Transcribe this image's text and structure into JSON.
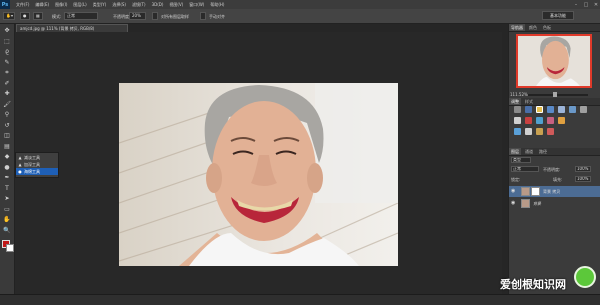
{
  "app": {
    "logo": "Ps",
    "window_controls": [
      "–",
      "□",
      "✕"
    ]
  },
  "menu": [
    "文件(F)",
    "编辑(E)",
    "图像(I)",
    "图层(L)",
    "类型(Y)",
    "选择(S)",
    "滤镜(T)",
    "3D(D)",
    "视图(V)",
    "窗口(W)",
    "帮助(H)"
  ],
  "options_bar": {
    "mode_label": "模式:",
    "mode_value": "正常",
    "opacity_label": "不透明度:",
    "opacity_value": "20%",
    "align_label": "对所有图层取样",
    "sample_label": "手动对齐",
    "workspace": "基本功能"
  },
  "document": {
    "tab_label": "amjcd.jpg @ 111% (背景 拷贝, RGB/8)"
  },
  "tools": [
    {
      "icon": "move-icon",
      "glyph": "✥"
    },
    {
      "icon": "marquee-icon",
      "glyph": "⬚"
    },
    {
      "icon": "lasso-icon",
      "glyph": "ϱ"
    },
    {
      "icon": "quick-select-icon",
      "glyph": "✎"
    },
    {
      "icon": "crop-icon",
      "glyph": "⌗"
    },
    {
      "icon": "eyedropper-icon",
      "glyph": "✐"
    },
    {
      "icon": "healing-icon",
      "glyph": "✚"
    },
    {
      "icon": "brush-icon",
      "glyph": "🖌"
    },
    {
      "icon": "stamp-icon",
      "glyph": "⚲"
    },
    {
      "icon": "history-brush-icon",
      "glyph": "↺"
    },
    {
      "icon": "eraser-icon",
      "glyph": "◫"
    },
    {
      "icon": "gradient-icon",
      "glyph": "▤"
    },
    {
      "icon": "blur-icon",
      "glyph": "◆"
    },
    {
      "icon": "dodge-icon",
      "glyph": "●"
    },
    {
      "icon": "pen-icon",
      "glyph": "✒"
    },
    {
      "icon": "type-icon",
      "glyph": "T"
    },
    {
      "icon": "path-select-icon",
      "glyph": "➤"
    },
    {
      "icon": "shape-icon",
      "glyph": "▭"
    },
    {
      "icon": "hand-icon",
      "glyph": "✋"
    },
    {
      "icon": "zoom-icon",
      "glyph": "🔍"
    }
  ],
  "flyout": {
    "items": [
      {
        "icon": "sponge-icon",
        "glyph": "▲",
        "label": "减淡工具",
        "selected": false
      },
      {
        "icon": "burn-icon",
        "glyph": "▲",
        "label": "加深工具",
        "selected": false
      },
      {
        "icon": "sponge-tool-icon",
        "glyph": "●",
        "label": "海绵工具",
        "selected": true
      }
    ]
  },
  "panels": {
    "navigator_tabs": [
      "导航器",
      "颜色",
      "色板"
    ],
    "zoom_readout": "111.52%",
    "adjustments_tabs": [
      "调整",
      "样式"
    ],
    "layers_tabs": [
      "图层",
      "通道",
      "路径"
    ],
    "layers_kind": "类型",
    "blend_mode": "正常",
    "layer_opacity_label": "不透明度:",
    "layer_opacity_value": "100%",
    "lock_label": "锁定:",
    "fill_label": "填充:",
    "fill_value": "100%",
    "layers": [
      {
        "name": "背景 拷贝",
        "selected": true
      },
      {
        "name": "背景",
        "selected": false
      }
    ]
  },
  "watermark": {
    "text": "爱创根知识网"
  },
  "colors": {
    "accent": "#1e5fb6",
    "foreground": "#c01818",
    "background": "#ffffff",
    "navigator_frame": "#e03a2a"
  }
}
